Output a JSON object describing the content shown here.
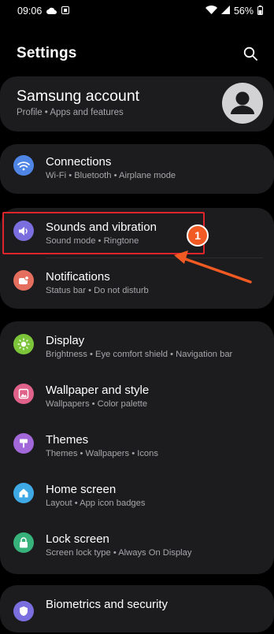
{
  "status_bar": {
    "time": "09:06",
    "battery": "56%"
  },
  "header": {
    "title": "Settings"
  },
  "account": {
    "title": "Samsung account",
    "subtitle": "Profile  •  Apps and features"
  },
  "rows": [
    {
      "title": "Connections",
      "subtitle": "Wi-Fi  •  Bluetooth  •  Airplane mode",
      "icon": "wifi-icon",
      "color": "#4f86e6"
    },
    {
      "title": "Sounds and vibration",
      "subtitle": "Sound mode  •  Ringtone",
      "icon": "speaker-icon",
      "color": "#7b6fe0"
    },
    {
      "title": "Notifications",
      "subtitle": "Status bar  •  Do not disturb",
      "icon": "notification-icon",
      "color": "#e56f5e"
    },
    {
      "title": "Display",
      "subtitle": "Brightness  •  Eye comfort shield  •  Navigation bar",
      "icon": "sun-icon",
      "color": "#7cc53a"
    },
    {
      "title": "Wallpaper and style",
      "subtitle": "Wallpapers  •  Color palette",
      "icon": "image-icon",
      "color": "#e0628b"
    },
    {
      "title": "Themes",
      "subtitle": "Themes  •  Wallpapers  •  Icons",
      "icon": "brush-icon",
      "color": "#a267d9"
    },
    {
      "title": "Home screen",
      "subtitle": "Layout  •  App icon badges",
      "icon": "home-icon",
      "color": "#3fa9e6"
    },
    {
      "title": "Lock screen",
      "subtitle": "Screen lock type  •  Always On Display",
      "icon": "lock-icon",
      "color": "#36b27a"
    },
    {
      "title": "Biometrics and security",
      "subtitle": "",
      "icon": "shield-icon",
      "color": "#7b6fe0"
    }
  ],
  "annotation": {
    "badge_number": "1",
    "accent": "#f15a22",
    "highlight_color": "#e0242c"
  }
}
